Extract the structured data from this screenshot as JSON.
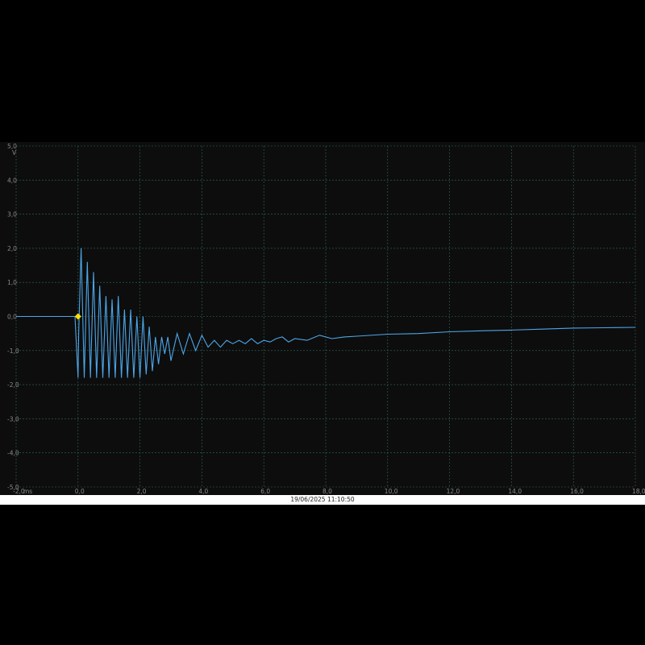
{
  "timestamp": "19/06/2025 11:10:50",
  "colors": {
    "trace": "#4da6e8",
    "trigger": "#ffe100",
    "grid": "#2f6b5a",
    "background": "#0d0d0d"
  },
  "chart_data": {
    "type": "line",
    "title": "",
    "xlabel": "ms",
    "ylabel": "V",
    "xlim": [
      -2.0,
      18.0
    ],
    "ylim": [
      -5.0,
      5.0
    ],
    "grid": true,
    "x_ticks": [
      "-2,0",
      "0,0",
      "2,0",
      "4,0",
      "6,0",
      "8,0",
      "10,0",
      "12,0",
      "14,0",
      "16,0",
      "18,0"
    ],
    "x_unit": "ms",
    "y_ticks": [
      "5,0",
      "4,0",
      "3,0",
      "2,0",
      "1,0",
      "0,0",
      "-1,0",
      "-2,0",
      "-3,0",
      "-4,0",
      "-5,0"
    ],
    "y_unit": "V",
    "trigger": {
      "x": 0.0,
      "y": 0.0
    },
    "series": [
      {
        "x": [
          -2.0,
          -0.1,
          0.0,
          0.02,
          0.1,
          0.2,
          0.3,
          0.4,
          0.5,
          0.6,
          0.7,
          0.8,
          0.9,
          1.0,
          1.1,
          1.2,
          1.3,
          1.4,
          1.5,
          1.6,
          1.7,
          1.8,
          1.9,
          2.0,
          2.1,
          2.2,
          2.3,
          2.4,
          2.5,
          2.6,
          2.7,
          2.8,
          2.9,
          3.0,
          3.2,
          3.4,
          3.6,
          3.8,
          4.0,
          4.2,
          4.4,
          4.6,
          4.8,
          5.0,
          5.2,
          5.4,
          5.6,
          5.8,
          6.0,
          6.2,
          6.4,
          6.6,
          6.8,
          7.0,
          7.4,
          7.8,
          8.2,
          8.6,
          9.0,
          10.0,
          11.0,
          12.0,
          13.0,
          14.0,
          15.0,
          16.0,
          17.0,
          18.0
        ],
        "values": [
          0.0,
          0.0,
          -1.8,
          -0.5,
          2.0,
          -1.8,
          1.6,
          -1.8,
          1.3,
          -1.8,
          0.9,
          -1.8,
          0.6,
          -1.8,
          0.5,
          -1.8,
          0.6,
          -1.8,
          0.2,
          -1.8,
          0.2,
          -1.8,
          0.0,
          -1.8,
          0.0,
          -1.7,
          -0.3,
          -1.6,
          -0.6,
          -1.4,
          -0.6,
          -1.1,
          -0.6,
          -1.3,
          -0.5,
          -1.1,
          -0.5,
          -1.0,
          -0.55,
          -0.9,
          -0.7,
          -0.9,
          -0.7,
          -0.8,
          -0.7,
          -0.8,
          -0.65,
          -0.8,
          -0.7,
          -0.75,
          -0.65,
          -0.6,
          -0.75,
          -0.65,
          -0.7,
          -0.55,
          -0.65,
          -0.6,
          -0.58,
          -0.52,
          -0.5,
          -0.45,
          -0.42,
          -0.4,
          -0.37,
          -0.34,
          -0.33,
          -0.32
        ]
      }
    ]
  }
}
